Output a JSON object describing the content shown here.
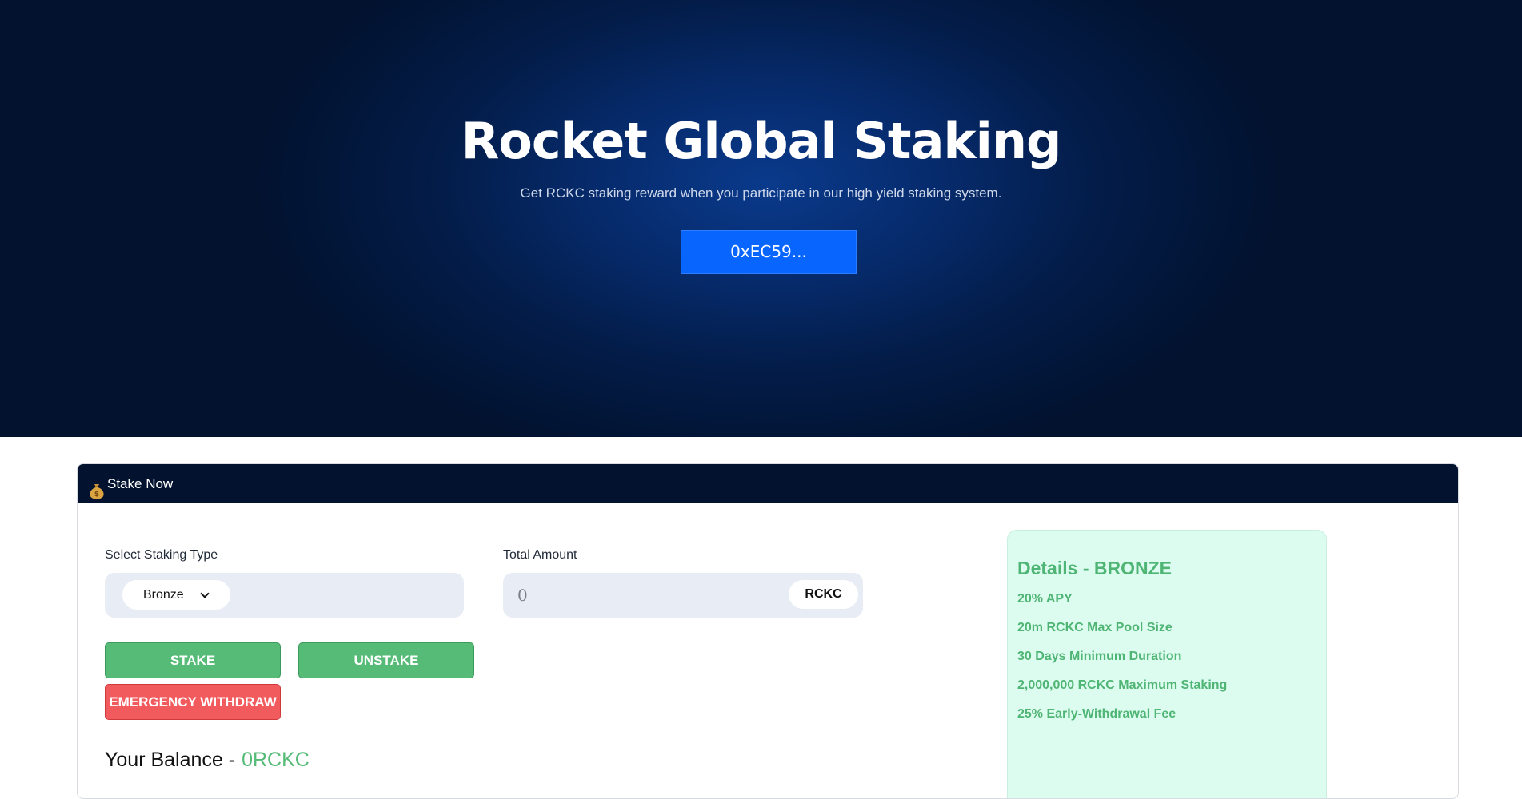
{
  "hero": {
    "title": "Rocket Global Staking",
    "subtitle": "Get RCKC staking reward when you participate in our high yield staking system.",
    "wallet_button": "0xEC59..."
  },
  "card": {
    "header_icon": "money-bag-icon",
    "header_title": "Stake Now",
    "staking_type_label": "Select Staking Type",
    "staking_type_selected": "Bronze",
    "total_amount_label": "Total Amount",
    "amount_placeholder": "0",
    "token_symbol": "RCKC",
    "stake_button": "STAKE",
    "unstake_button": "UNSTAKE",
    "emergency_button": "EMERGENCY WITHDRAW",
    "balance_label": "Your Balance -",
    "balance_value": "0RCKC"
  },
  "details": {
    "title": "Details - BRONZE",
    "items": [
      "20% APY",
      "20m RCKC Max Pool Size",
      "30 Days Minimum Duration",
      "2,000,000 RCKC Maximum Staking",
      "25% Early-Withdrawal Fee"
    ]
  },
  "colors": {
    "hero_bg": "#02122f",
    "primary_blue": "#0866ff",
    "green": "#55bb77",
    "red": "#f25b5e",
    "details_bg": "#dcfcf0"
  }
}
